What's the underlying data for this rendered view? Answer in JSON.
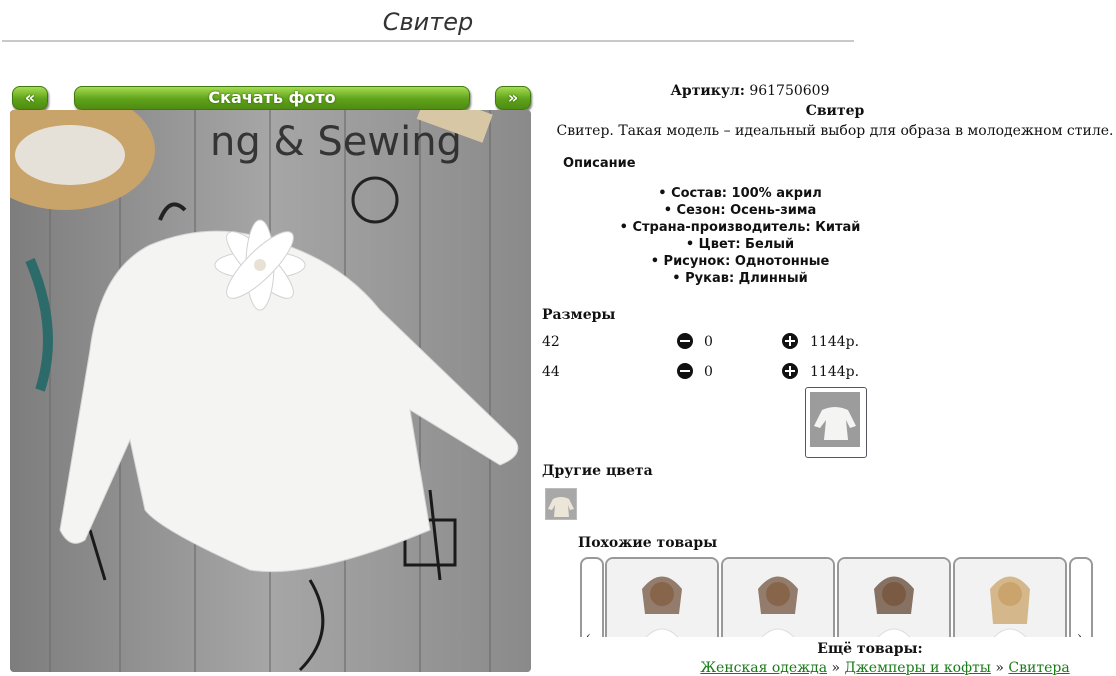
{
  "header": {
    "title": "Свитер"
  },
  "gallery": {
    "prev_label": "«",
    "download_label": "Скачать фото",
    "next_label": "»",
    "photo_text": "ng & Sewing"
  },
  "product": {
    "article_label": "Артикул:",
    "article_value": "961750609",
    "name": "Свитер",
    "intro": "Свитер. Такая модель – идеальный выбор для образа в молодежном стиле.",
    "description_heading": "Описание",
    "specs": [
      "• Состав: 100% акрил",
      "• Сезон: Осень-зима",
      "• Страна-производитель: Китай",
      "• Цвет: Белый",
      "• Рисунок: Однотонные",
      "• Рукав: Длинный"
    ]
  },
  "sizes": {
    "heading": "Размеры",
    "rows": [
      {
        "size": "42",
        "qty": "0",
        "price": "1144р."
      },
      {
        "size": "44",
        "qty": "0",
        "price": "1144р."
      }
    ]
  },
  "other_colors": {
    "heading": "Другие цвета"
  },
  "similar": {
    "heading": "Похожие товары"
  },
  "more": {
    "heading": "Ещё товары:",
    "crumb1": "Женская одежда",
    "sep1": " » ",
    "crumb2": "Джемперы и кофты",
    "sep2": " » ",
    "crumb3": "Свитера"
  },
  "colors": {
    "green": "#5fa21a",
    "link": "#1a7a1a"
  }
}
